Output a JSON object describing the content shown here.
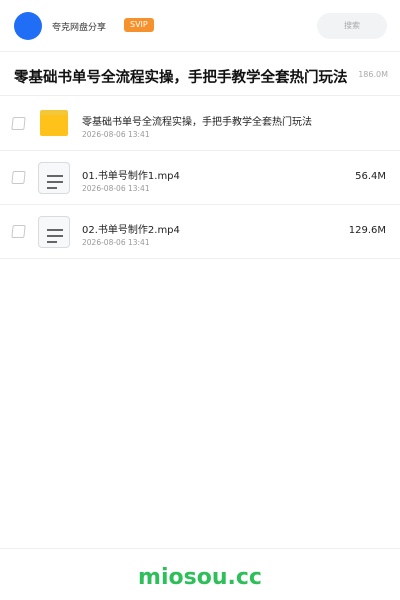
{
  "header": {
    "app_name": "夸克网盘分享",
    "badge": "SVIP",
    "search_placeholder": "搜索"
  },
  "share": {
    "title": "零基础书单号全流程实操，手把手教学全套热门玩法",
    "total_size": "186.0M"
  },
  "files": [
    {
      "name": "零基础书单号全流程实操，手把手教学全套热门玩法",
      "date": "2026-08-06 13:41",
      "size": "",
      "icon": "folder-icon"
    },
    {
      "name": "01.书单号制作1.mp4",
      "date": "2026-08-06 13:41",
      "size": "56.4M",
      "icon": "video-file-icon"
    },
    {
      "name": "02.书单号制作2.mp4",
      "date": "2026-08-06 13:41",
      "size": "129.6M",
      "icon": "video-file-icon"
    }
  ],
  "footer": {
    "watermark": "miosou.cc"
  },
  "colors": {
    "avatar": "#1f6ef5",
    "badge": "#f6922e",
    "folder": "#ffc21a",
    "watermark": "#2fbf5a"
  }
}
